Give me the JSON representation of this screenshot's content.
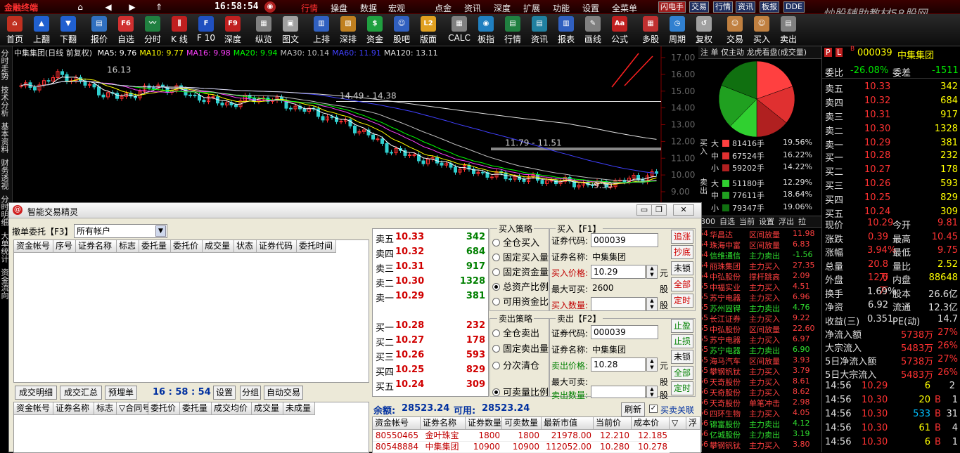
{
  "app": {
    "logo": "金融终端",
    "clock": "16:58:54",
    "watermark": "炒股辅助教材58股网 www.58Gu.com"
  },
  "menu": [
    "行情",
    "操盘",
    "数据",
    "宏观",
    "点金",
    "资讯",
    "深度",
    "扩展",
    "功能",
    "设置",
    "全菜单"
  ],
  "quick": [
    "闪电手",
    "交易",
    "行情",
    "资讯",
    "板报",
    "DDE"
  ],
  "toolbar": [
    {
      "label": "首页",
      "icon": "home-icon",
      "color": "#c03020",
      "glyph": "⌂"
    },
    {
      "label": "上翻",
      "icon": "up-arrow-icon",
      "color": "#2060d0",
      "glyph": "▲"
    },
    {
      "label": "下翻",
      "icon": "down-arrow-icon",
      "color": "#2060d0",
      "glyph": "▼"
    },
    {
      "label": "报价",
      "icon": "quote-icon",
      "color": "#3070c0",
      "glyph": "▤"
    },
    {
      "label": "自选",
      "icon": "f6-icon",
      "color": "#d03030",
      "glyph": "F6"
    },
    {
      "label": "分时",
      "icon": "minute-chart-icon",
      "color": "#208040",
      "glyph": "〰"
    },
    {
      "label": "K 线",
      "icon": "kline-icon",
      "color": "#c02020",
      "glyph": "⫼"
    },
    {
      "label": "F 10",
      "icon": "f10-icon",
      "color": "#2050c0",
      "glyph": "F"
    },
    {
      "label": "深度",
      "icon": "f9-icon",
      "color": "#c02020",
      "glyph": "F9"
    },
    {
      "label": "纵览",
      "icon": "overview-icon",
      "color": "#808080",
      "glyph": "▦"
    },
    {
      "label": "图文",
      "icon": "doc-icon",
      "color": "#a0a0a0",
      "glyph": "▣"
    },
    {
      "label": "上排",
      "icon": "rank-up-icon",
      "color": "#3060c0",
      "glyph": "▥"
    },
    {
      "label": "深排",
      "icon": "rank-deep-icon",
      "color": "#c08020",
      "glyph": "▧"
    },
    {
      "label": "资金",
      "icon": "money-icon",
      "color": "#20a040",
      "glyph": "$"
    },
    {
      "label": "股吧",
      "icon": "forum-icon",
      "color": "#3060c0",
      "glyph": "☺"
    },
    {
      "label": "版面",
      "icon": "l2-icon",
      "color": "#e0a020",
      "glyph": "L2"
    },
    {
      "label": "CALC",
      "icon": "calc-icon",
      "color": "#808080",
      "glyph": "▦"
    },
    {
      "label": "板指",
      "icon": "index-icon",
      "color": "#2080c0",
      "glyph": "◉"
    },
    {
      "label": "行情",
      "icon": "market-icon",
      "color": "#208040",
      "glyph": "▤"
    },
    {
      "label": "资讯",
      "icon": "news-icon",
      "color": "#2080a0",
      "glyph": "▤"
    },
    {
      "label": "报表",
      "icon": "report-icon",
      "color": "#3060c0",
      "glyph": "▥"
    },
    {
      "label": "画线",
      "icon": "draw-line-icon",
      "color": "#808080",
      "glyph": "✎"
    },
    {
      "label": "公式",
      "icon": "formula-icon",
      "color": "#c02020",
      "glyph": "Aa"
    },
    {
      "label": "多股",
      "icon": "multi-stock-icon",
      "color": "#c03030",
      "glyph": "▦"
    },
    {
      "label": "周期",
      "icon": "period-icon",
      "color": "#3080d0",
      "glyph": "◷"
    },
    {
      "label": "复权",
      "icon": "restore-icon",
      "color": "#a0a0a0",
      "glyph": "↺"
    },
    {
      "label": "交易",
      "icon": "trade-icon",
      "color": "#c08040",
      "glyph": "☺"
    },
    {
      "label": "买入",
      "icon": "buy-icon",
      "color": "#c08040",
      "glyph": "☺"
    },
    {
      "label": "卖出",
      "icon": "sell-icon",
      "color": "#808080",
      "glyph": "▤"
    }
  ],
  "lefttabs": [
    "分时走势",
    "技术分析",
    "基本资料",
    "财务透视",
    "分时明细",
    "大单统计",
    "资金流向"
  ],
  "kline": {
    "name": "中集集团(日线 前复权)",
    "ma": [
      {
        "label": "MA5: 9.76",
        "color": "#ffffff"
      },
      {
        "label": "MA10: 9.77",
        "color": "#ffff00"
      },
      {
        "label": "MA16: 9.98",
        "color": "#ff40ff"
      },
      {
        "label": "MA20: 9.94",
        "color": "#00ff00"
      },
      {
        "label": "MA30: 10.14",
        "color": "#c0c0c0"
      },
      {
        "label": "MA60: 11.91",
        "color": "#4040ff"
      },
      {
        "label": "MA120: 13.11",
        "color": "#e0e0e0"
      }
    ],
    "yticks": [
      "17.00",
      "16.00",
      "15.00",
      "14.00",
      "13.00",
      "12.00",
      "11.00",
      "10.00",
      "9.00"
    ],
    "annotations": [
      "16.13",
      "14.49 - 14.38",
      "11.79 - 11.51",
      "9.30"
    ]
  },
  "pie": {
    "header": "仅主动 龙虎看盘(成交量)",
    "slices": [
      {
        "pct": 19.56,
        "color": "#ff4040"
      },
      {
        "pct": 16.22,
        "color": "#e03030"
      },
      {
        "pct": 14.22,
        "color": "#b02020"
      },
      {
        "pct": 12.29,
        "color": "#30d030"
      },
      {
        "pct": 18.64,
        "color": "#20a020"
      },
      {
        "pct": 19.06,
        "color": "#107010"
      }
    ],
    "rows": [
      {
        "side": "大",
        "vol": "81416手",
        "pct": "19.56%",
        "color": "#ff4040"
      },
      {
        "side": "中",
        "vol": "67524手",
        "pct": "16.22%",
        "color": "#e03030"
      },
      {
        "side": "小",
        "vol": "59202手",
        "pct": "14.22%",
        "color": "#b02020"
      },
      {
        "side": "大",
        "vol": "51180手",
        "pct": "12.29%",
        "color": "#30d030"
      },
      {
        "side": "中",
        "vol": "77611手",
        "pct": "18.64%",
        "color": "#20a020"
      },
      {
        "side": "小",
        "vol": "79347手",
        "pct": "19.06%",
        "color": "#107010"
      }
    ],
    "buy_label": "买入",
    "sell_label": "卖出",
    "tabs": [
      "300",
      "自选",
      "当前",
      "设置",
      "浮出",
      "拉"
    ]
  },
  "quote": {
    "code": "000039",
    "name": "中集集团",
    "webi": "委比",
    "webi_val": "-26.08%",
    "weicha": "委差",
    "weicha_val": "-1511",
    "sell": [
      {
        "l": "卖五",
        "p": "10.33",
        "v": "342"
      },
      {
        "l": "卖四",
        "p": "10.32",
        "v": "684"
      },
      {
        "l": "卖三",
        "p": "10.31",
        "v": "917"
      },
      {
        "l": "卖二",
        "p": "10.30",
        "v": "1328"
      },
      {
        "l": "卖一",
        "p": "10.29",
        "v": "381"
      }
    ],
    "buy": [
      {
        "l": "买一",
        "p": "10.28",
        "v": "232"
      },
      {
        "l": "买二",
        "p": "10.27",
        "v": "178"
      },
      {
        "l": "买三",
        "p": "10.26",
        "v": "593"
      },
      {
        "l": "买四",
        "p": "10.25",
        "v": "829"
      },
      {
        "l": "买五",
        "p": "10.24",
        "v": "309"
      }
    ],
    "stats": [
      [
        "现价",
        "10.29",
        "今开",
        "9.81"
      ],
      [
        "涨跌",
        "0.39",
        "最高",
        "10.45"
      ],
      [
        "涨幅",
        "3.94%",
        "最低",
        "9.75"
      ],
      [
        "总量",
        "20.8万",
        "量比",
        "2.52"
      ],
      [
        "外盘",
        "12.0万",
        "内盘",
        "88648"
      ],
      [
        "换手",
        "1.69%",
        "股本",
        "26.6亿"
      ],
      [
        "净资",
        "6.92",
        "流通",
        "12.3亿"
      ],
      [
        "收益(三)",
        "0.351",
        "PE(动)",
        "14.7"
      ]
    ],
    "flows": [
      [
        "净流入额",
        "5738万",
        "27%"
      ],
      [
        "大宗流入",
        "5483万",
        "26%"
      ],
      [
        "5日净流入额",
        "5738万",
        "27%"
      ],
      [
        "5日大宗流入",
        "5483万",
        "26%"
      ]
    ],
    "trades": [
      [
        "14:56",
        "10.29",
        "6",
        "2"
      ],
      [
        "14:56",
        "10.30",
        "20",
        "B",
        "1"
      ],
      [
        "14:56",
        "10.30",
        "533",
        "B",
        "31"
      ],
      [
        "14:56",
        "10.30",
        "61",
        "B",
        "4"
      ],
      [
        "14:56",
        "10.30",
        "6",
        "B",
        "1"
      ]
    ]
  },
  "ticks": [
    [
      "54",
      "华昌达",
      "区间放量",
      "11.98"
    ],
    [
      "54",
      "珠海中富",
      "区间放量",
      "6.83"
    ],
    [
      "54",
      "信维通信",
      "主力卖出",
      "-1.56"
    ],
    [
      "54",
      "丽珠集团",
      "主力买入",
      "27.35"
    ],
    [
      "54",
      "中弘股份",
      "撑杆跳高",
      "2.09"
    ],
    [
      "55",
      "中福实业",
      "主力买入",
      "4.51"
    ],
    [
      "55",
      "苏宁电器",
      "主力买入",
      "6.96"
    ],
    [
      "55",
      "苏州固锝",
      "主力卖出",
      "4.76"
    ],
    [
      "55",
      "长江证券",
      "主力买入",
      "9.22"
    ],
    [
      "55",
      "中弘股份",
      "区间放量",
      "22.60"
    ],
    [
      "55",
      "苏宁电器",
      "主力买入",
      "6.97"
    ],
    [
      "55",
      "苏宁电器",
      "主力卖出",
      "6.90"
    ],
    [
      "55",
      "海马汽车",
      "区间放量",
      "3.93"
    ],
    [
      "55",
      "攀钢钒钛",
      "主力买入",
      "3.79"
    ],
    [
      "56",
      "天奇股份",
      "主力买入",
      "8.61"
    ],
    [
      "56",
      "天奇股份",
      "主力买入",
      "8.62"
    ],
    [
      "56",
      "天奇股份",
      "单笔冲击",
      "2.98"
    ],
    [
      "56",
      "四环生物",
      "主力买入",
      "4.05"
    ],
    [
      "56",
      "锦富股份",
      "主力卖出",
      "4.12"
    ],
    [
      "56",
      "亿城股份",
      "主力卖出",
      "3.19"
    ],
    [
      "56",
      "攀钢钒钛",
      "主力买入",
      "3.80"
    ]
  ],
  "dialog": {
    "title": "智能交易精灵",
    "cancel_tab": "撤单委托【F3】",
    "account": "所有帐户",
    "cols_top": [
      "资金帐号",
      "序号",
      "证券名称",
      "标志",
      "委托量",
      "委托价",
      "成交量",
      "状态",
      "证券代码",
      "委托时间"
    ],
    "btns_mid": [
      "成交明细",
      "成交汇总",
      "预埋单"
    ],
    "mid_clock": "16 : 58 : 54",
    "mid_btns": [
      "设置",
      "分组",
      "自动交易"
    ],
    "cols_bottom": [
      "资金帐号",
      "证券名称",
      "标志",
      "▽合同号",
      "委托价",
      "委托量",
      "成交均价",
      "成交量",
      "未成量"
    ],
    "ob_sell": [
      {
        "l": "卖五",
        "p": "10.33",
        "v": "342"
      },
      {
        "l": "卖四",
        "p": "10.32",
        "v": "684"
      },
      {
        "l": "卖三",
        "p": "10.31",
        "v": "917"
      },
      {
        "l": "卖二",
        "p": "10.30",
        "v": "1328"
      },
      {
        "l": "卖一",
        "p": "10.29",
        "v": "381"
      }
    ],
    "ob_buy": [
      {
        "l": "买一",
        "p": "10.28",
        "v": "232"
      },
      {
        "l": "买二",
        "p": "10.27",
        "v": "178"
      },
      {
        "l": "买三",
        "p": "10.26",
        "v": "593"
      },
      {
        "l": "买四",
        "p": "10.25",
        "v": "829"
      },
      {
        "l": "买五",
        "p": "10.24",
        "v": "309"
      }
    ],
    "buy_strategy": "买入策略",
    "buy_opts": [
      "全仓买入",
      "固定买入量",
      "固定资金量",
      "总资产比例",
      "可用资金比"
    ],
    "sell_strategy": "卖出策略",
    "sell_opts": [
      "全仓卖出",
      "固定卖出量",
      "分次清仓",
      "可卖量比例"
    ],
    "buy_title": "买入【F1】",
    "sell_title": "卖出【F2】",
    "code_label": "证券代码:",
    "name_label": "证券名称:",
    "code": "000039",
    "name": "中集集团",
    "buy_price_label": "买入价格:",
    "buy_price": "10.29",
    "max_buy_label": "最大可买:",
    "max_buy": "2600",
    "buy_qty_label": "买入数量:",
    "sell_price_label": "卖出价格:",
    "sell_price": "10.28",
    "max_sell_label": "最大可卖:",
    "sell_qty_label": "卖出数量:",
    "unit_yuan": "元",
    "unit_gu": "股",
    "buy_btns": [
      "追涨",
      "抄底",
      "未锁",
      "全部",
      "定时"
    ],
    "sell_btns": [
      "止盈",
      "止损",
      "未锁",
      "全部",
      "定时"
    ],
    "balance_label": "余额:",
    "balance": "28523.24",
    "avail_label": "可用:",
    "avail": "28523.24",
    "refresh": "刷新",
    "link_label": "买卖关联",
    "hold_cols": [
      "资金帐号",
      "证券名称",
      "证券数量",
      "可卖数量",
      "最新市值",
      "当前价",
      "成本价",
      "▽",
      "浮"
    ],
    "holdings": [
      [
        "80550465",
        "金叶珠宝",
        "1800",
        "1800",
        "21978.00",
        "12.210",
        "12.185"
      ],
      [
        "80548884",
        "中集集团",
        "10900",
        "10900",
        "112052.00",
        "10.280",
        "10.278"
      ]
    ]
  }
}
